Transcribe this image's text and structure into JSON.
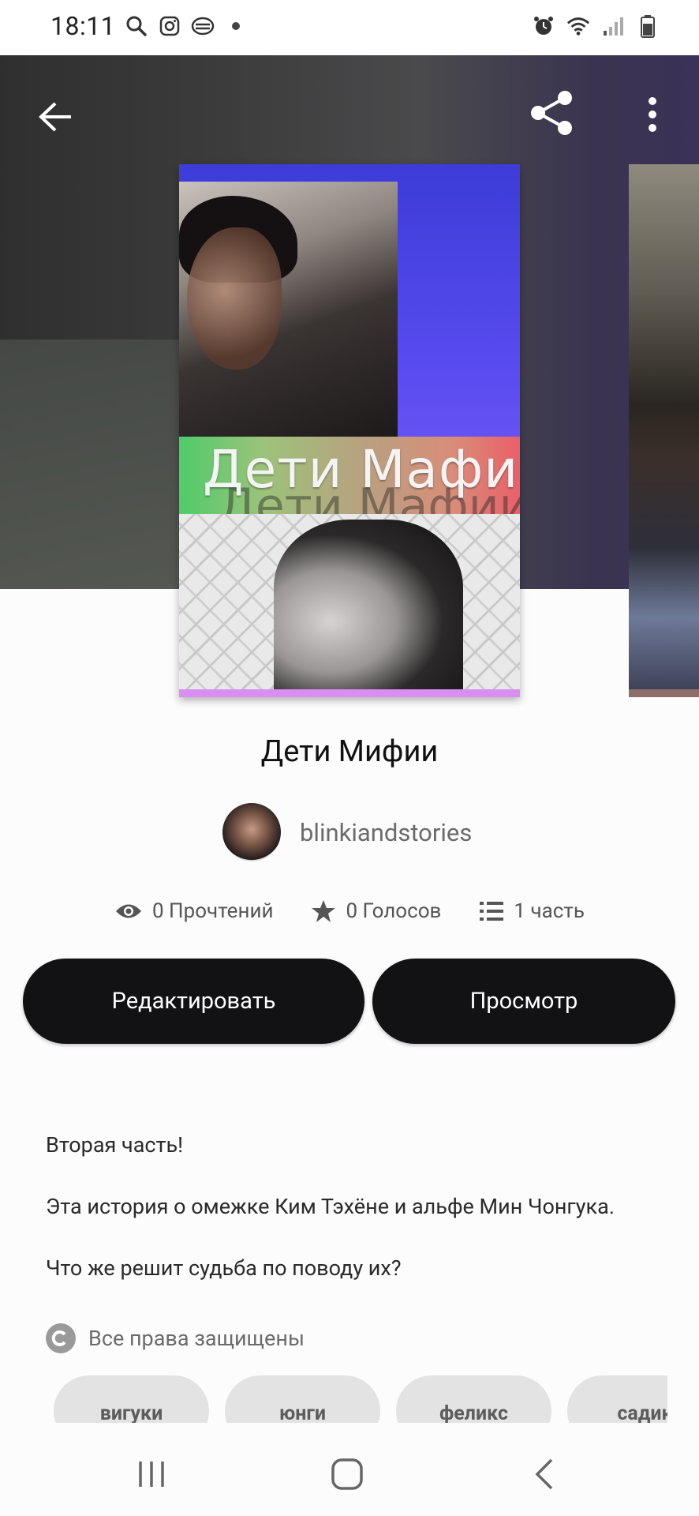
{
  "status_bar": {
    "time": "18:11",
    "left_icons": [
      "search-icon",
      "instagram-icon",
      "app-icon",
      "dot-icon"
    ],
    "right_icons": [
      "alarm-icon",
      "wifi-icon",
      "signal-icon",
      "battery-icon"
    ]
  },
  "header": {
    "back_icon": "arrow-left-icon",
    "share_icon": "share-icon",
    "more_icon": "more-vertical-icon"
  },
  "cover": {
    "title_text": "Дети Мафии"
  },
  "story": {
    "title": "Дети Мифии",
    "author": "blinkiandstories"
  },
  "stats": {
    "reads": "0 Прочтений",
    "votes": "0 Голосов",
    "parts": "1 часть"
  },
  "buttons": {
    "edit": "Редактировать",
    "view": "Просмотр"
  },
  "description": {
    "line1": "Вторая часть!",
    "line2": "Эта история о омежке Ким Тэхёне и альфе Мин Чонгука.",
    "line3": "Что же решит судьба по поводу их?"
  },
  "copyright": "Все права защищены",
  "tags": [
    "вигуки",
    "юнги",
    "феликс",
    "садик"
  ],
  "nav": {
    "recent_icon": "recent-apps-icon",
    "home_icon": "home-icon",
    "back_icon": "nav-back-icon"
  }
}
